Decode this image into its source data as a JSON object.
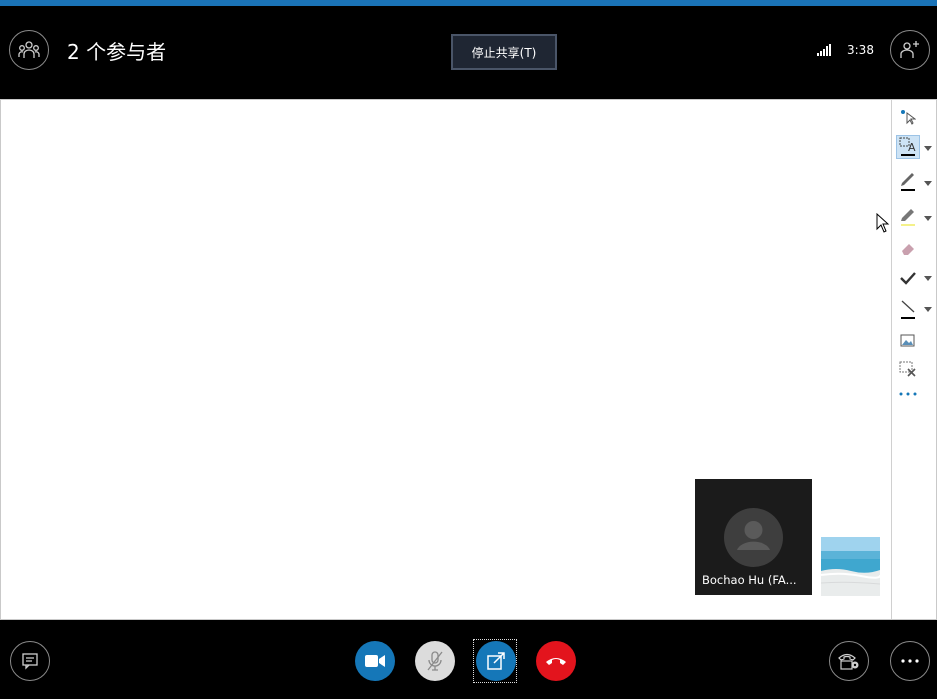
{
  "header": {
    "title": "2 个参与者",
    "stop_share_label": "停止共享(T)",
    "clock": "3:38",
    "icons": {
      "participants": "participants-icon",
      "signal": "signal-strength-icon",
      "add_people": "add-people-icon"
    }
  },
  "stage": {
    "participant": {
      "name": "Bochao Hu (FA..."
    },
    "self_preview": "beach-thumbnail"
  },
  "toolbar": {
    "tools": [
      "pointer-tool-icon",
      "text-tool-icon",
      "pen-tool-icon",
      "highlighter-tool-icon",
      "eraser-tool-icon",
      "stamp-check-icon",
      "line-tool-icon",
      "insert-image-icon",
      "delete-selection-icon",
      "more-tools-icon"
    ]
  },
  "footer": {
    "icons": [
      "chat-icon",
      "video-camera-icon",
      "microphone-muted-icon",
      "present-icon",
      "hang-up-icon",
      "call-controls-icon",
      "more-options-icon"
    ]
  },
  "colors": {
    "accent": "#1a73b7",
    "video_button": "#1577b8",
    "hangup_button": "#e3141d",
    "mute_button": "#dcdcdc"
  }
}
